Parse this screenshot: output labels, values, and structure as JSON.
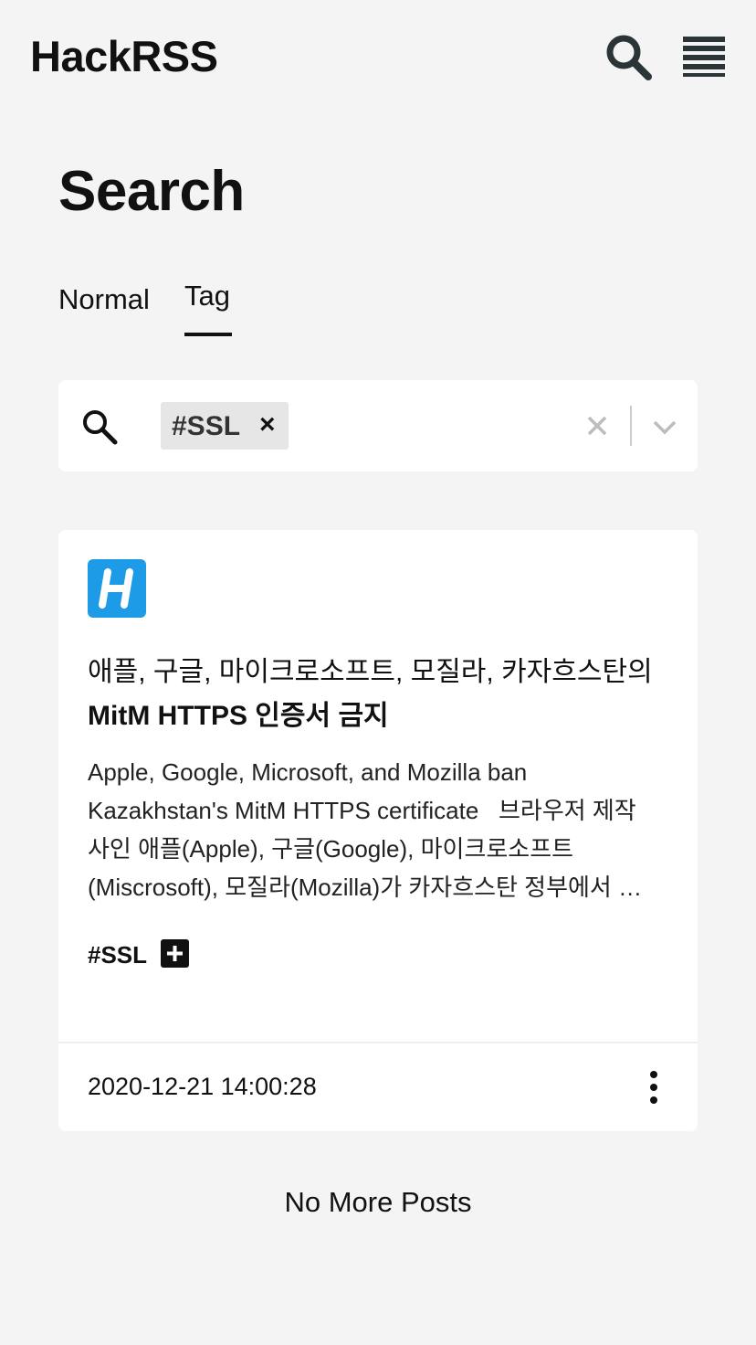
{
  "header": {
    "brand": "HackRSS",
    "search_icon": "search-icon",
    "menu_icon": "menu-icon"
  },
  "page": {
    "title": "Search"
  },
  "tabs": [
    {
      "label": "Normal",
      "active": false
    },
    {
      "label": "Tag",
      "active": true
    }
  ],
  "search": {
    "icon": "search-icon",
    "chip_label": "#SSL",
    "chip_remove": "×",
    "clear_icon": "close-icon",
    "dropdown_icon": "chevron-down-icon"
  },
  "post": {
    "logo_icon": "hackrss-logo",
    "title_part1": "애플, 구글, 마이크로소프트, 모질라, 카자흐스탄의",
    "title_part2": "MitM HTTPS 인증서 금지",
    "excerpt_lines": [
      "Apple, Google, Microsoft, and Mozilla ban",
      "Kazakhstan's MitM HTTPS certificate   브라우저 제작",
      "사인 애플(Apple), 구글(Google), 마이크로소프트",
      "(Miscrosoft), 모질라(Mozilla)가 카자흐스탄 정부에서 …"
    ],
    "tag": "#SSL",
    "add_tag_icon": "plus-icon",
    "date": "2020-12-21 14:00:28",
    "more_icon": "more-vertical-icon"
  },
  "footer": {
    "no_more": "No More Posts"
  },
  "colors": {
    "background": "#f4f4f4",
    "card": "#ffffff",
    "logo_bg": "#1e9be6",
    "chip_bg": "#e6e6e6",
    "text": "#111111"
  }
}
